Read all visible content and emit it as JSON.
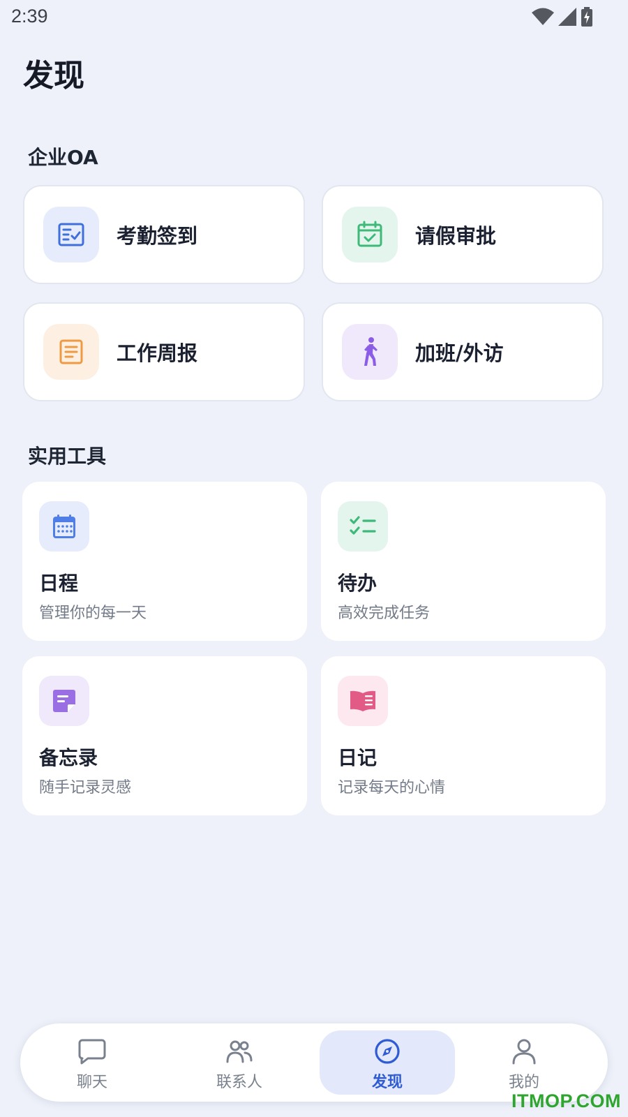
{
  "status_bar": {
    "time": "2:39",
    "icons": [
      "wifi-icon",
      "cellular-signal-icon",
      "battery-charging-icon"
    ]
  },
  "page": {
    "title": "发现"
  },
  "enterprise_oa": {
    "section_title": "企业OA",
    "items": [
      {
        "label": "考勤签到",
        "icon": "attendance-checkin-icon",
        "icon_color": "#3e6fdb",
        "icon_bg": "#e6ecfb"
      },
      {
        "label": "请假审批",
        "icon": "calendar-check-icon",
        "icon_color": "#3fb979",
        "icon_bg": "#e3f5ec"
      },
      {
        "label": "工作周报",
        "icon": "report-document-icon",
        "icon_color": "#ee9a43",
        "icon_bg": "#fdf0e3"
      },
      {
        "label": "加班/外访",
        "icon": "walking-person-icon",
        "icon_color": "#8b5ce6",
        "icon_bg": "#efe9fb"
      }
    ]
  },
  "tools": {
    "section_title": "实用工具",
    "items": [
      {
        "title": "日程",
        "subtitle": "管理你的每一天",
        "icon": "calendar-icon",
        "icon_color": "#4f7fe6",
        "icon_bg": "#e6ecfb"
      },
      {
        "title": "待办",
        "subtitle": "高效完成任务",
        "icon": "checklist-icon",
        "icon_color": "#3fb979",
        "icon_bg": "#e3f5ec"
      },
      {
        "title": "备忘录",
        "subtitle": "随手记录灵感",
        "icon": "memo-note-icon",
        "icon_color": "#9a6fe3",
        "icon_bg": "#efe9fb"
      },
      {
        "title": "日记",
        "subtitle": "记录每天的心情",
        "icon": "open-book-icon",
        "icon_color": "#e25a86",
        "icon_bg": "#fce8ee"
      }
    ]
  },
  "bottom_nav": {
    "items": [
      {
        "label": "聊天",
        "icon": "chat-bubble-icon",
        "active": false
      },
      {
        "label": "联系人",
        "icon": "contacts-icon",
        "active": false
      },
      {
        "label": "发现",
        "icon": "compass-icon",
        "active": true
      },
      {
        "label": "我的",
        "icon": "profile-icon",
        "active": false
      }
    ],
    "active_color": "#2f5bd3",
    "inactive_color": "#7a818e"
  },
  "watermark": "ITMOP.COM"
}
